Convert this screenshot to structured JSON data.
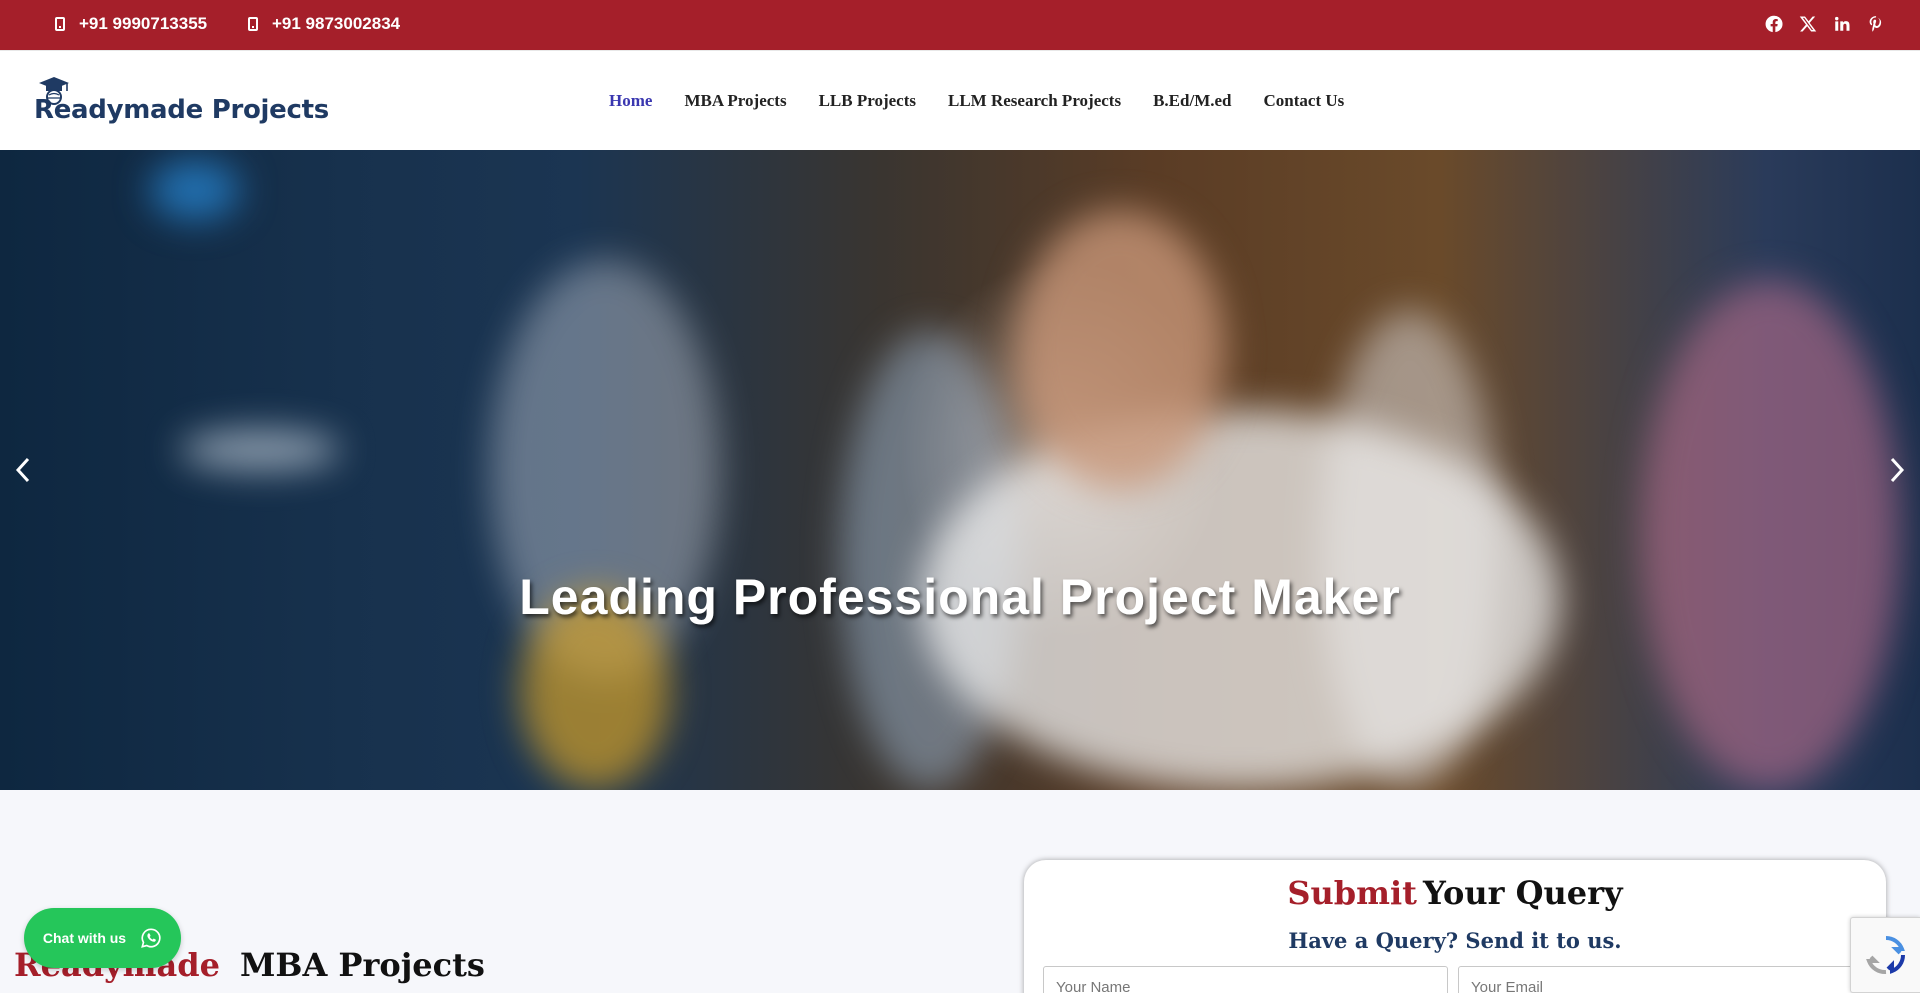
{
  "topbar": {
    "phones": [
      "+91 9990713355",
      "+91 9873002834"
    ],
    "socials": [
      "facebook-icon",
      "x-twitter-icon",
      "linkedin-icon",
      "pinterest-icon"
    ],
    "background": "#a51f2a"
  },
  "header": {
    "logo_text": "Readymade Projects",
    "nav": [
      {
        "label": "Home",
        "active": true
      },
      {
        "label": "MBA Projects",
        "active": false
      },
      {
        "label": "LLB Projects",
        "active": false
      },
      {
        "label": "LLM Research Projects",
        "active": false
      },
      {
        "label": "B.Ed/M.ed",
        "active": false
      },
      {
        "label": "Contact Us",
        "active": false
      }
    ],
    "active_color": "#3a37b0"
  },
  "hero": {
    "title": "Leading Professional Project Maker",
    "prev_icon": "chevron-left-icon",
    "next_icon": "chevron-right-icon"
  },
  "section": {
    "title_red": "Readymade",
    "title_rest": "MBA Projects"
  },
  "query": {
    "title_red": "Submit",
    "title_rest": "Your Query",
    "subtitle": "Have a Query? Send it to us.",
    "name_placeholder": "Your Name",
    "email_placeholder": "Your Email"
  },
  "chat": {
    "label": "Chat with us",
    "icon": "whatsapp-icon",
    "color": "#25c65a"
  },
  "recaptcha": {
    "icon": "recaptcha-icon"
  }
}
